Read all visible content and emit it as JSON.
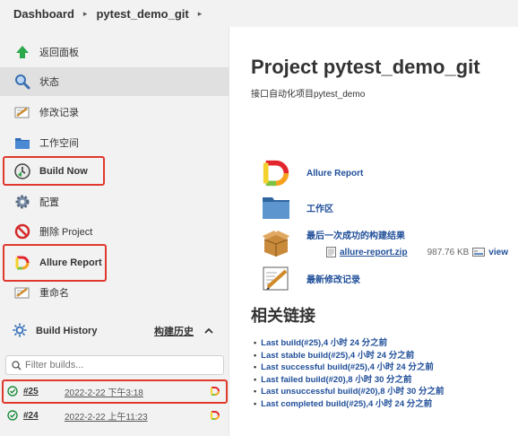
{
  "breadcrumb": {
    "items": [
      "Dashboard",
      "pytest_demo_git"
    ]
  },
  "sidebar": {
    "items": [
      {
        "label": "返回面板",
        "icon": "up-arrow-icon"
      },
      {
        "label": "状态",
        "icon": "search-icon"
      },
      {
        "label": "修改记录",
        "icon": "notepad-icon"
      },
      {
        "label": "工作空间",
        "icon": "folder-icon"
      },
      {
        "label": "Build Now",
        "icon": "build-clock-icon"
      },
      {
        "label": "配置",
        "icon": "gear-icon"
      },
      {
        "label": "删除 Project",
        "icon": "no-entry-icon"
      },
      {
        "label": "Allure Report",
        "icon": "allure-icon"
      },
      {
        "label": "重命名",
        "icon": "notepad-icon"
      }
    ]
  },
  "build_history": {
    "title": "Build History",
    "trend_link": "构建历史",
    "filter_placeholder": "Filter builds...",
    "builds": [
      {
        "number": "#25",
        "date": "2022-2-22 下午3:18"
      },
      {
        "number": "#24",
        "date": "2022-2-22 上午11:23"
      }
    ]
  },
  "main": {
    "title": "Project pytest_demo_git",
    "description": "接口自动化项目pytest_demo",
    "links": [
      {
        "label": "Allure Report",
        "icon": "allure-icon"
      },
      {
        "label": "工作区",
        "icon": "folder-icon"
      },
      {
        "label": "最后一次成功的构建结果",
        "icon": "package-icon"
      },
      {
        "label": "最新修改记录",
        "icon": "notepad-icon"
      }
    ],
    "artifact": {
      "name": "allure-report.zip",
      "size": "987.76 KB",
      "view": "view"
    },
    "related_title": "相关链接",
    "related_links": [
      "Last build(#25),4 小时 24 分之前",
      "Last stable build(#25),4 小时 24 分之前",
      "Last successful build(#25),4 小时 24 分之前",
      "Last failed build(#20),8 小时 30 分之前",
      "Last unsuccessful build(#20),8 小时 30 分之前",
      "Last completed build(#25),4 小时 24 分之前"
    ]
  },
  "colors": {
    "link": "#1f4e99",
    "highlight": "#e0382c",
    "sidebar_bg": "#f2f2f2",
    "success": "#1e8e3e"
  }
}
